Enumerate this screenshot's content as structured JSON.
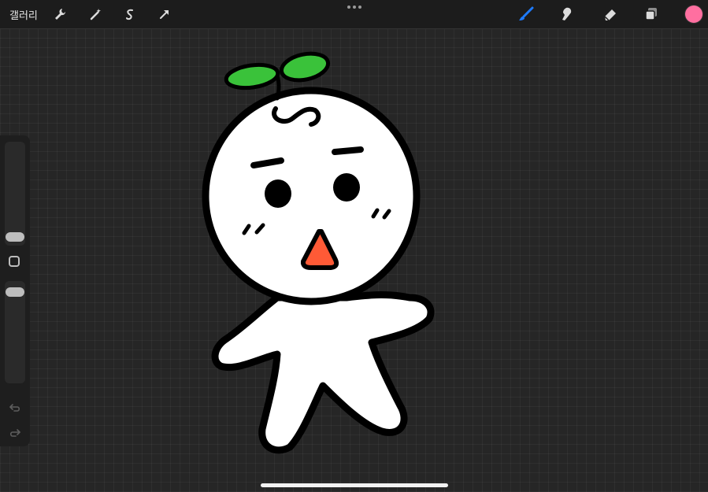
{
  "topbar": {
    "gallery_label": "갤러리",
    "left_tools": [
      "wrench-icon",
      "magic-wand-icon",
      "selection-s-icon",
      "transform-arrow-icon"
    ],
    "right_tools": [
      "brush-icon",
      "smudge-icon",
      "eraser-icon",
      "layers-icon"
    ],
    "current_color": "#ff6fa0",
    "accent_color": "#1e7bff"
  },
  "sidebar": {
    "brush_size_level": 0.5,
    "opacity_level": 0.5,
    "controls": [
      "brush-size-slider",
      "modify-button",
      "opacity-slider",
      "undo-icon",
      "redo-icon"
    ]
  },
  "artwork": {
    "subject": "character",
    "colors": {
      "leaf": "#3ac23a",
      "mouth": "#ff5a36",
      "outline": "#000000",
      "fill": "#ffffff"
    }
  }
}
